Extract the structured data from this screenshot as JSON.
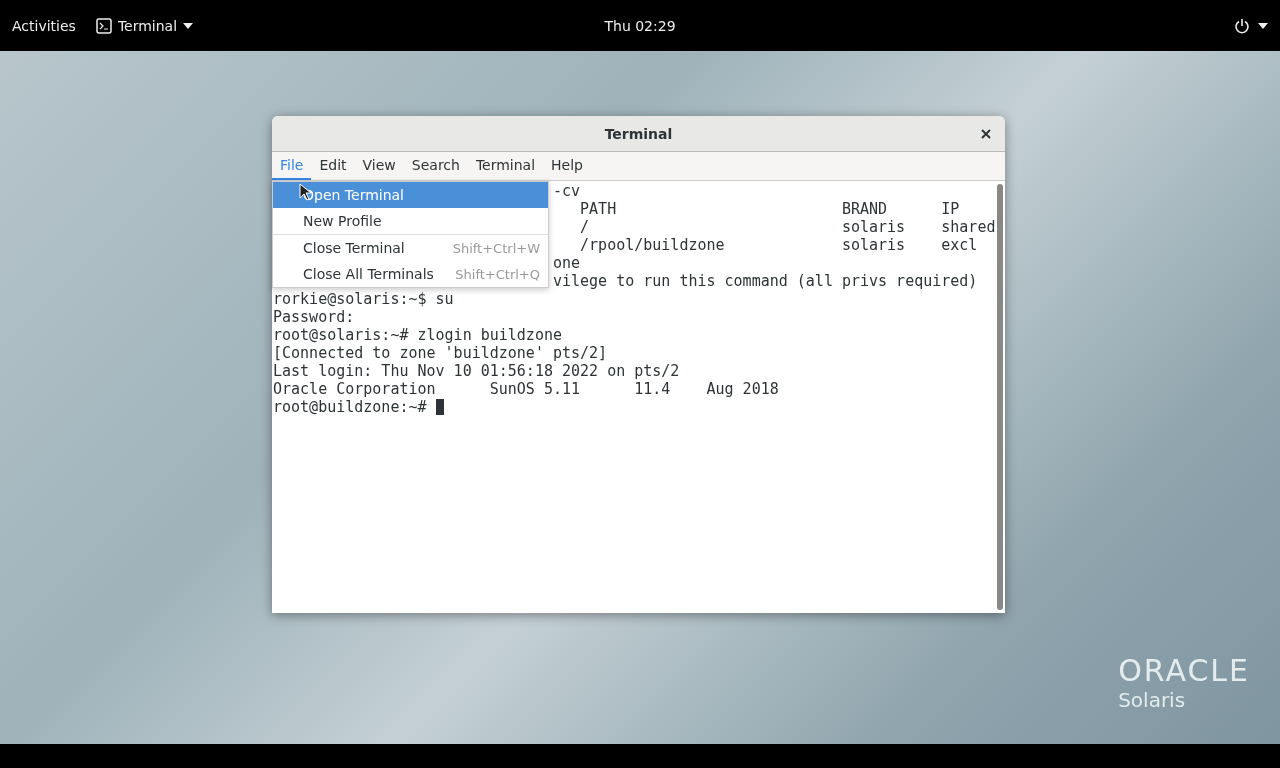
{
  "top_bar": {
    "activities": "Activities",
    "app_menu": {
      "label": "Terminal"
    },
    "clock": "Thu 02:29"
  },
  "window": {
    "title": "Terminal",
    "menubar": [
      {
        "label": "File",
        "selected": true
      },
      {
        "label": "Edit",
        "selected": false
      },
      {
        "label": "View",
        "selected": false
      },
      {
        "label": "Search",
        "selected": false
      },
      {
        "label": "Terminal",
        "selected": false
      },
      {
        "label": "Help",
        "selected": false
      }
    ],
    "file_menu": {
      "groups": [
        [
          {
            "label": "Open Terminal",
            "selected": true
          },
          {
            "label": "New Profile",
            "selected": false
          }
        ],
        [
          {
            "label": "Close Terminal",
            "shortcut": "Shift+Ctrl+W",
            "selected": false
          },
          {
            "label": "Close All Terminals",
            "shortcut": "Shift+Ctrl+Q",
            "selected": false
          }
        ]
      ]
    },
    "terminal": {
      "lines": [
        {
          "kind": "covered",
          "text": "-cv"
        },
        {
          "kind": "covered",
          "text": "   PATH                         BRAND      IP"
        },
        {
          "kind": "covered",
          "text": "   /                            solaris    shared"
        },
        {
          "kind": "covered",
          "text": "   /rpool/buildzone             solaris    excl"
        },
        {
          "kind": "covered",
          "text": "one"
        },
        {
          "kind": "covered",
          "text": "vilege to run this command (all privs required)"
        },
        {
          "kind": "plain",
          "text": "rorkie@solaris:~$ su"
        },
        {
          "kind": "plain",
          "text": "Password:"
        },
        {
          "kind": "plain",
          "text": "root@solaris:~# zlogin buildzone"
        },
        {
          "kind": "plain",
          "text": "[Connected to zone 'buildzone' pts/2]"
        },
        {
          "kind": "plain",
          "text": "Last login: Thu Nov 10 01:56:18 2022 on pts/2"
        },
        {
          "kind": "plain",
          "text": "Oracle Corporation      SunOS 5.11      11.4    Aug 2018"
        },
        {
          "kind": "prompt",
          "text": "root@buildzone:~# "
        }
      ]
    }
  },
  "desktop": {
    "logo": {
      "brand": "ORACLE",
      "product": "Solaris"
    }
  }
}
